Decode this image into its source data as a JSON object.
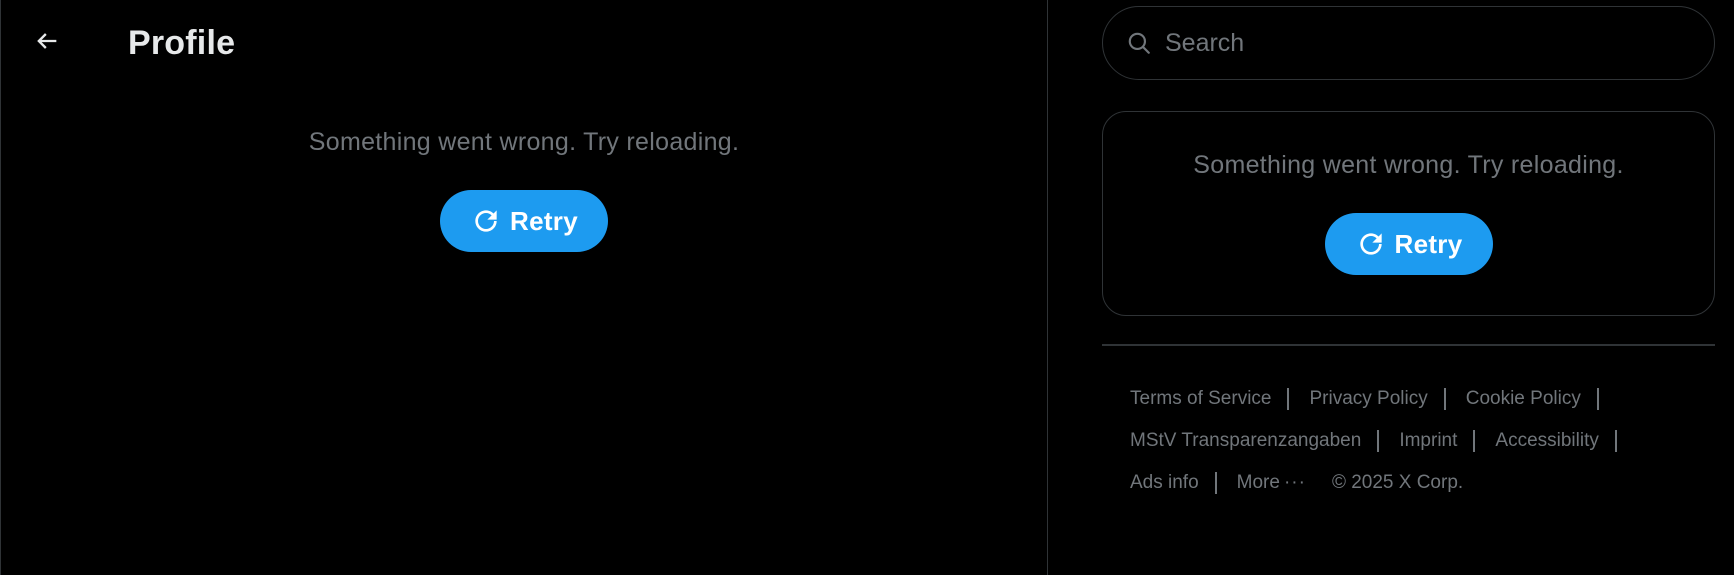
{
  "header": {
    "title": "Profile",
    "back_icon": "arrow-left-icon"
  },
  "main": {
    "error_text": "Something went wrong. Try reloading.",
    "retry_label": "Retry",
    "retry_icon": "refresh-icon"
  },
  "search": {
    "placeholder": "Search",
    "value": "",
    "icon": "search-icon"
  },
  "sidebar_card": {
    "error_text": "Something went wrong. Try reloading.",
    "retry_label": "Retry",
    "retry_icon": "refresh-icon"
  },
  "footer": {
    "links": {
      "terms": "Terms of Service",
      "privacy": "Privacy Policy",
      "cookie": "Cookie Policy",
      "mstv": "MStV Transparenzangaben",
      "imprint": "Imprint",
      "accessibility": "Accessibility",
      "ads": "Ads info",
      "more": "More",
      "more_icon": "···"
    },
    "copyright": "© 2025 X Corp."
  },
  "colors": {
    "background": "#000000",
    "accent": "#1d9bf0",
    "muted_text": "#71767b",
    "border": "#2f3336",
    "primary_text": "#e7e9ea"
  }
}
